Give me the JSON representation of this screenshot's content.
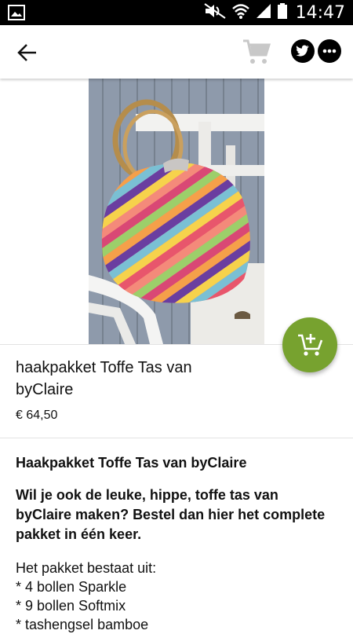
{
  "status_bar": {
    "time": "14:47",
    "icons": [
      "gallery-icon",
      "mute-icon",
      "wifi-icon",
      "signal-icon",
      "battery-icon"
    ]
  },
  "app_bar": {
    "back_icon": "arrow-left-icon",
    "cart_icon": "cart-icon",
    "twitter_icon": "twitter-icon",
    "more_icon": "more-horizontal-icon"
  },
  "product": {
    "title": "haakpakket Toffe Tas van byClaire",
    "price": "€ 64,50",
    "image_alt": "crochet bag with bamboo handles"
  },
  "description": {
    "heading": "Haakpakket Toffe Tas van byClaire",
    "intro": "Wil je ook de leuke, hippe, toffe tas van byClaire maken? Bestel dan hier het complete pakket in één keer.",
    "lines": [
      "Het pakket bestaat uit:",
      "* 4 bollen Sparkle",
      "* 9 bollen Softmix",
      "* tashengsel bamboe"
    ]
  },
  "fab": {
    "icon": "add-to-cart-icon"
  },
  "colors": {
    "fab": "#77a22f",
    "status_bar": "#000000",
    "divider": "#e3e3e3"
  }
}
